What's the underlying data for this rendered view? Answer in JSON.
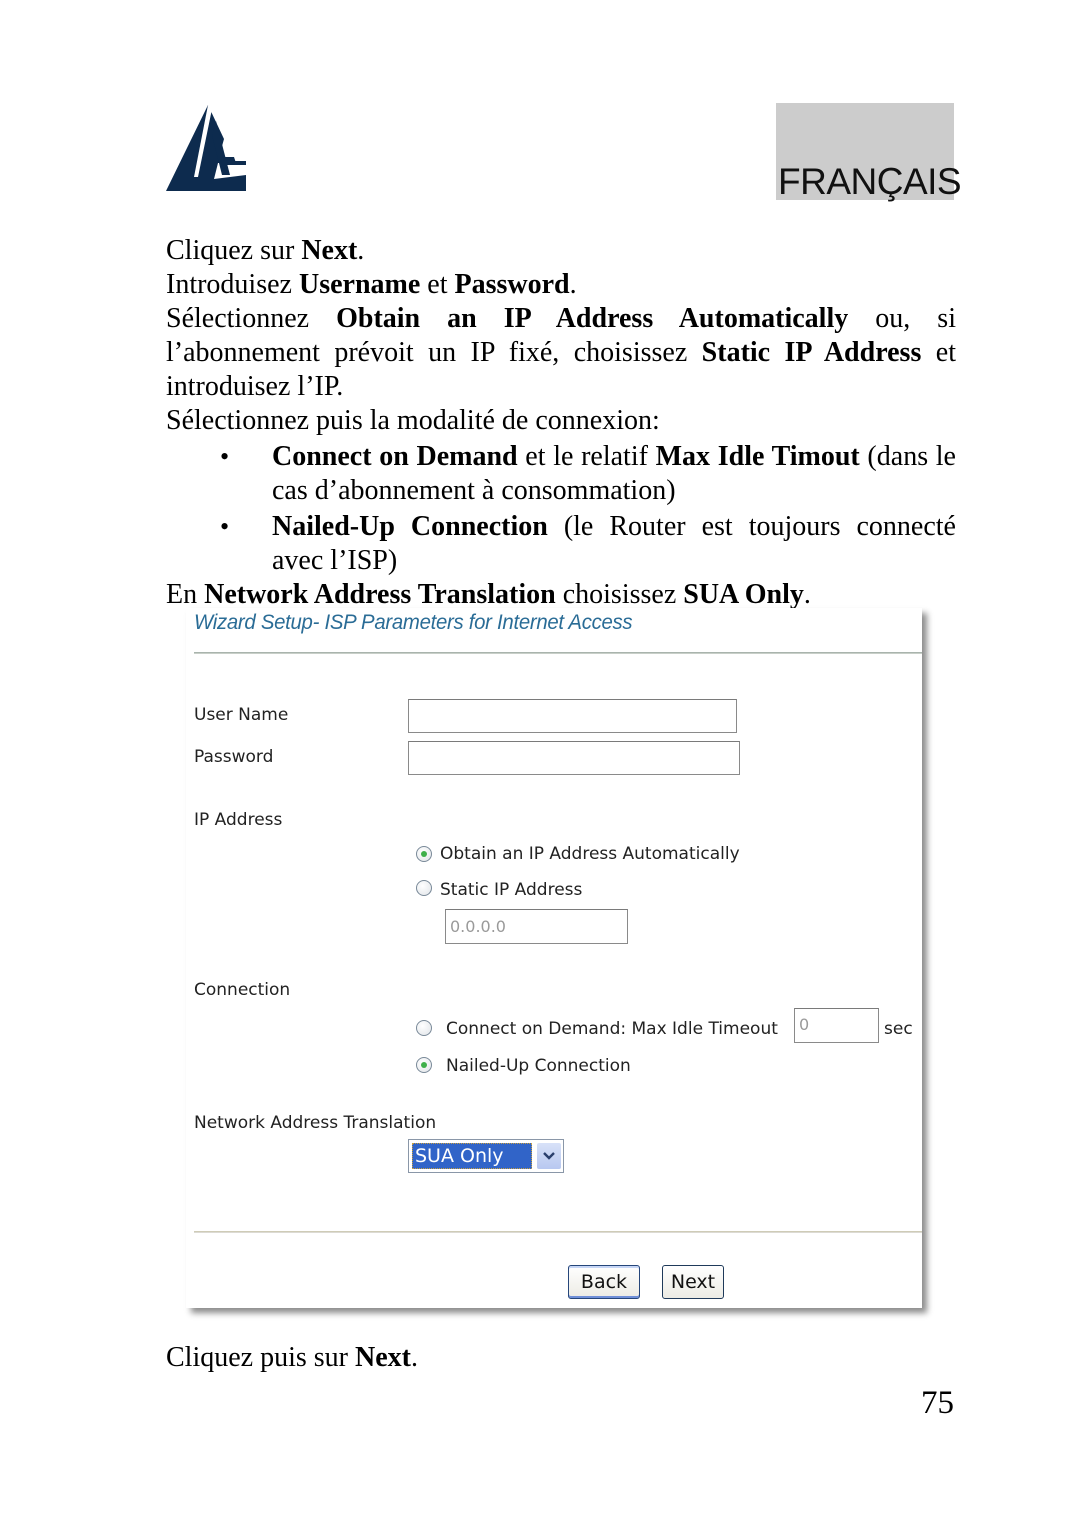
{
  "header": {
    "logo_icon": "atlantis-sail-logo-icon",
    "language_label": "FRANÇAIS"
  },
  "instructions": {
    "line1": {
      "pre": "Cliquez sur ",
      "b1": "Next",
      "post": "."
    },
    "line2": {
      "pre": "Introduisez ",
      "b1": "Username",
      "mid": " et ",
      "b2": "Password",
      "post": "."
    },
    "line3": {
      "pre": "Sélectionnez ",
      "b1": "Obtain an IP Address Automatically",
      "mid": " ou, si l’abonnement prévoit un IP fixé, choisissez ",
      "b2": "Static IP Address",
      "post": " et introduisez l’IP."
    },
    "line4": "Sélectionnez puis la modalité de connexion:",
    "bullets": [
      {
        "b1": "Connect on Demand",
        "mid": " et le relatif ",
        "b2": "Max Idle Timout",
        "post": " (dans le cas d’abonnement à consommation)"
      },
      {
        "b1": "Nailed-Up Connection",
        "post": " (le Router est toujours connecté avec l’ISP)"
      }
    ],
    "line5": {
      "pre": "En ",
      "b1": "Network Address Translation",
      "mid": " choisissez ",
      "b2": "SUA Only",
      "post": "."
    }
  },
  "wizard": {
    "title": "Wizard Setup- ISP Parameters for Internet Access",
    "user_name_label": "User Name",
    "user_name_value": "",
    "password_label": "Password",
    "password_value": "",
    "ip_address_label": "IP Address",
    "ip_options": [
      {
        "label": "Obtain an IP Address Automatically",
        "checked": true
      },
      {
        "label": "Static IP Address",
        "checked": false
      }
    ],
    "static_ip_value": "0.0.0.0",
    "connection_label": "Connection",
    "connection_options": [
      {
        "label": "Connect on Demand: Max Idle Timeout",
        "checked": false
      },
      {
        "label": "Nailed-Up Connection",
        "checked": true
      }
    ],
    "idle_timeout_value": "0",
    "idle_timeout_unit": "sec",
    "nat_label": "Network Address Translation",
    "nat_selected": "SUA Only",
    "back_label": "Back",
    "next_label": "Next"
  },
  "footer": {
    "closing": {
      "pre": "Cliquez puis sur ",
      "b1": "Next",
      "post": "."
    },
    "page_number": "75"
  }
}
